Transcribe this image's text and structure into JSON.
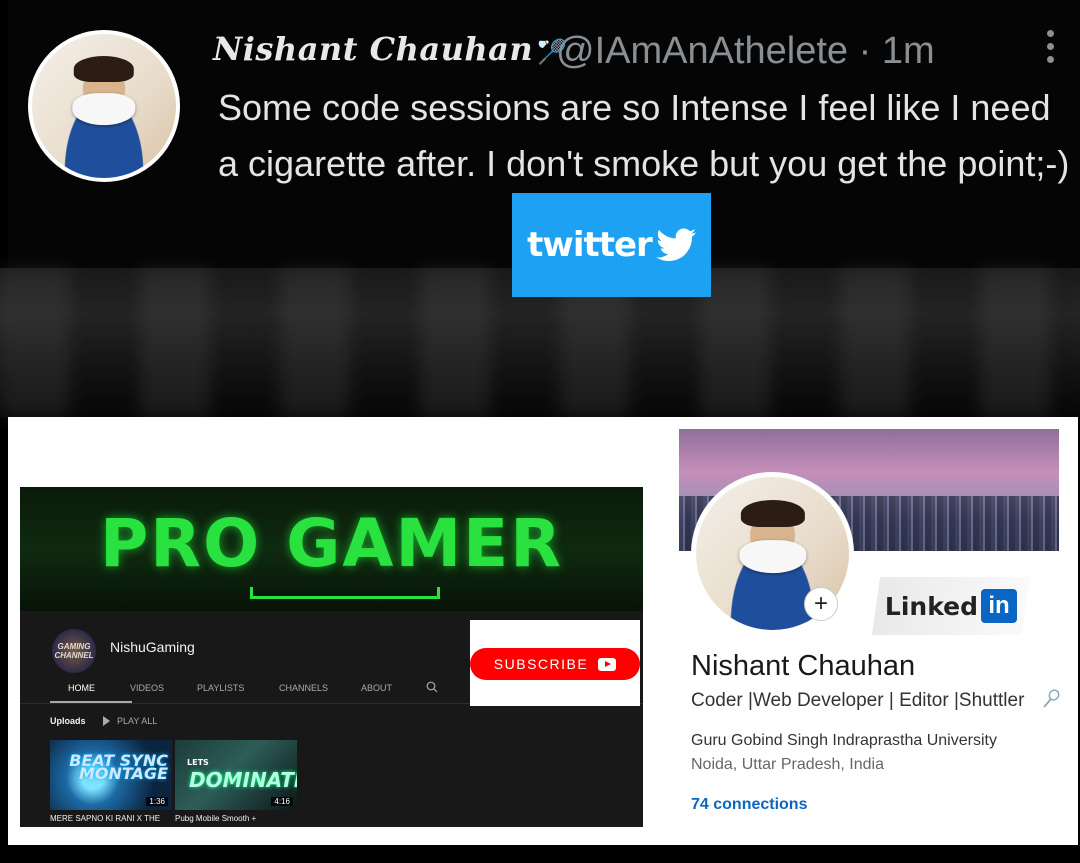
{
  "tweet": {
    "author_name": "Nishant Chauhan",
    "author_emoji": "🏸",
    "handle_time": "@IAmAnAthelete · 1m",
    "text": "Some code sessions are so Intense I feel like I need a cigarette after. I don't smoke but you get the point;-)",
    "more_icon": "more-vertical-icon"
  },
  "twitter_badge": {
    "word": "twitter",
    "icon": "twitter-bird-icon",
    "color": "#1da1f2"
  },
  "youtube": {
    "banner_text": "PRO GAMER",
    "channel_icon_text": "GAMING CHANNEL",
    "channel_name": "NishuGaming",
    "tabs": [
      "HOME",
      "VIDEOS",
      "PLAYLISTS",
      "CHANNELS",
      "ABOUT"
    ],
    "active_tab": "HOME",
    "section_title": "Uploads",
    "play_all": "PLAY ALL",
    "videos": [
      {
        "thumb_text": "BEAT SYNC MONTAGE",
        "duration": "1:36",
        "title": "MERE SAPNO KI RANI X THE"
      },
      {
        "thumb_sub": "LETS",
        "thumb_text": "DOMINATE",
        "duration": "4:16",
        "title": "Pubg Mobile Smooth +"
      }
    ],
    "subscribe_label": "SUBSCRIBE",
    "accent": "#ff0000"
  },
  "linkedin": {
    "logo_word": "Linked",
    "logo_in": "in",
    "name": "Nishant Chauhan",
    "headline": "Coder |Web Developer | Editor |Shuttler",
    "education": "Guru Gobind Singh Indraprastha University",
    "location": "Noida, Uttar Pradesh, India",
    "connections": "74 connections",
    "add_icon": "+",
    "accent": "#0a66c2"
  }
}
